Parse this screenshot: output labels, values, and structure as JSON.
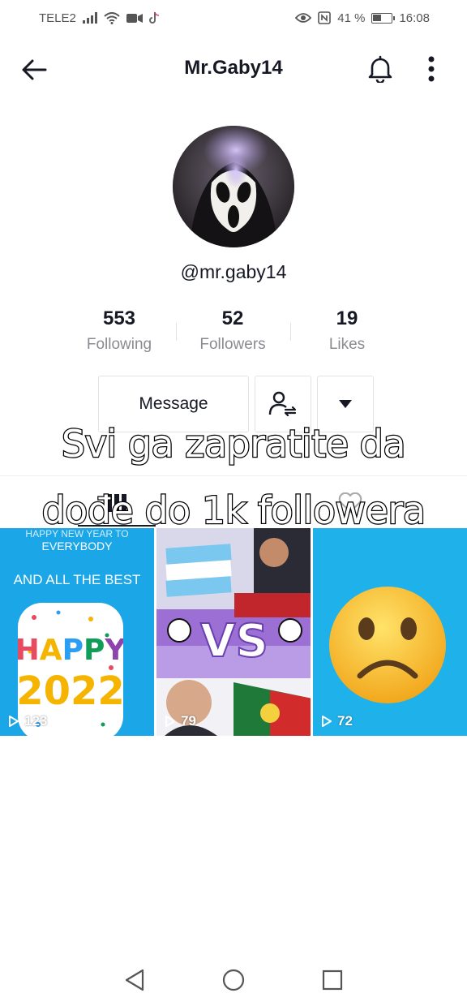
{
  "status": {
    "carrier": "TELE2",
    "battery": "41 %",
    "time": "16:08"
  },
  "header": {
    "title": "Mr.Gaby14"
  },
  "profile": {
    "username": "@mr.gaby14"
  },
  "stats": [
    {
      "value": "553",
      "label": "Following"
    },
    {
      "value": "52",
      "label": "Followers"
    },
    {
      "value": "19",
      "label": "Likes"
    }
  ],
  "actions": {
    "message_label": "Message"
  },
  "caption": {
    "line1": "Svi ga zapratite da",
    "line2": "dođe do 1k followera"
  },
  "videos": [
    {
      "views": "123",
      "top_text": "HAPPY NEW YEAR TO",
      "subtext": "EVERYBODY",
      "headline": "AND ALL THE BEST",
      "card_word": "HAPPY",
      "card_year": "2022"
    },
    {
      "views": "79",
      "center_text": "VS"
    },
    {
      "views": "72"
    }
  ],
  "colors": {
    "text_primary": "#161823",
    "text_secondary": "#8a8b91",
    "tile_blue": "#1ba6e8"
  }
}
